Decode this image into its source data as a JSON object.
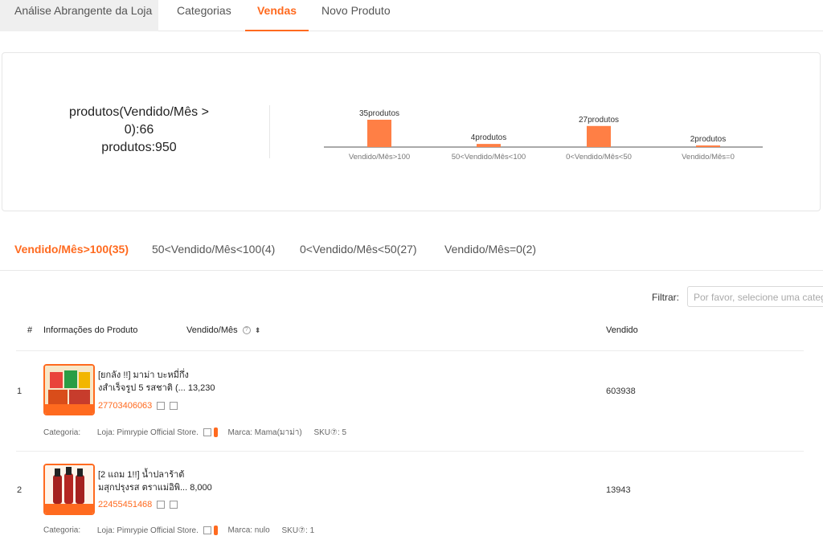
{
  "tabs": [
    {
      "label": "Análise Abrangente da Loja"
    },
    {
      "label": "Categorias"
    },
    {
      "label": "Vendas"
    },
    {
      "label": "Novo Produto"
    }
  ],
  "summary": {
    "line1": "produtos(Vendido/Mês >",
    "line2": "0):66",
    "line3": "produtos:950"
  },
  "chart_data": {
    "type": "bar",
    "categories": [
      "Vendido/Mês>100",
      "50<Vendido/Mês<100",
      "0<Vendido/Mês<50",
      "Vendido/Mês=0"
    ],
    "values": [
      35,
      4,
      27,
      2
    ],
    "data_labels": [
      "35produtos",
      "4produtos",
      "27produtos",
      "2produtos"
    ],
    "color": "#ff7f45"
  },
  "filter_tabs": [
    {
      "label": "Vendido/Mês>100(35)"
    },
    {
      "label": "50<Vendido/Mês<100(4)"
    },
    {
      "label": "0<Vendido/Mês<50(27)"
    },
    {
      "label": "Vendido/Mês=0(2)"
    }
  ],
  "filter": {
    "label": "Filtrar",
    "placeholder": "Por favor, selecione uma categoria"
  },
  "table": {
    "headers": {
      "index": "#",
      "info": "Informações do Produto",
      "monthly": "Vendido/Mês",
      "sold": "Vendido"
    },
    "rows": [
      {
        "index": "1",
        "name_line1": "[ยกลัง !!] มาม่า บะหมี่กึ่ง",
        "name_line2": "งสำเร็จรูป 5 รสชาติ (...",
        "monthly": "13,230",
        "id": "27703406063",
        "sold": "603938",
        "category_label": "Categoria:",
        "store": "Loja: Pimrypie Official Store.",
        "brand": "Marca: Mama(มาม่า)",
        "sku": "SKU⑦: 5"
      },
      {
        "index": "2",
        "name_line1": "[2 แถม 1!!] น้ำปลาร้าต้",
        "name_line2": "มสุกปรุงรส ตราแม่อิพิ...",
        "monthly": "8,000",
        "id": "22455451468",
        "sold": "13943",
        "category_label": "Categoria:",
        "store": "Loja: Pimrypie Official Store.",
        "brand": "Marca: nulo",
        "sku": "SKU⑦: 1"
      }
    ]
  }
}
